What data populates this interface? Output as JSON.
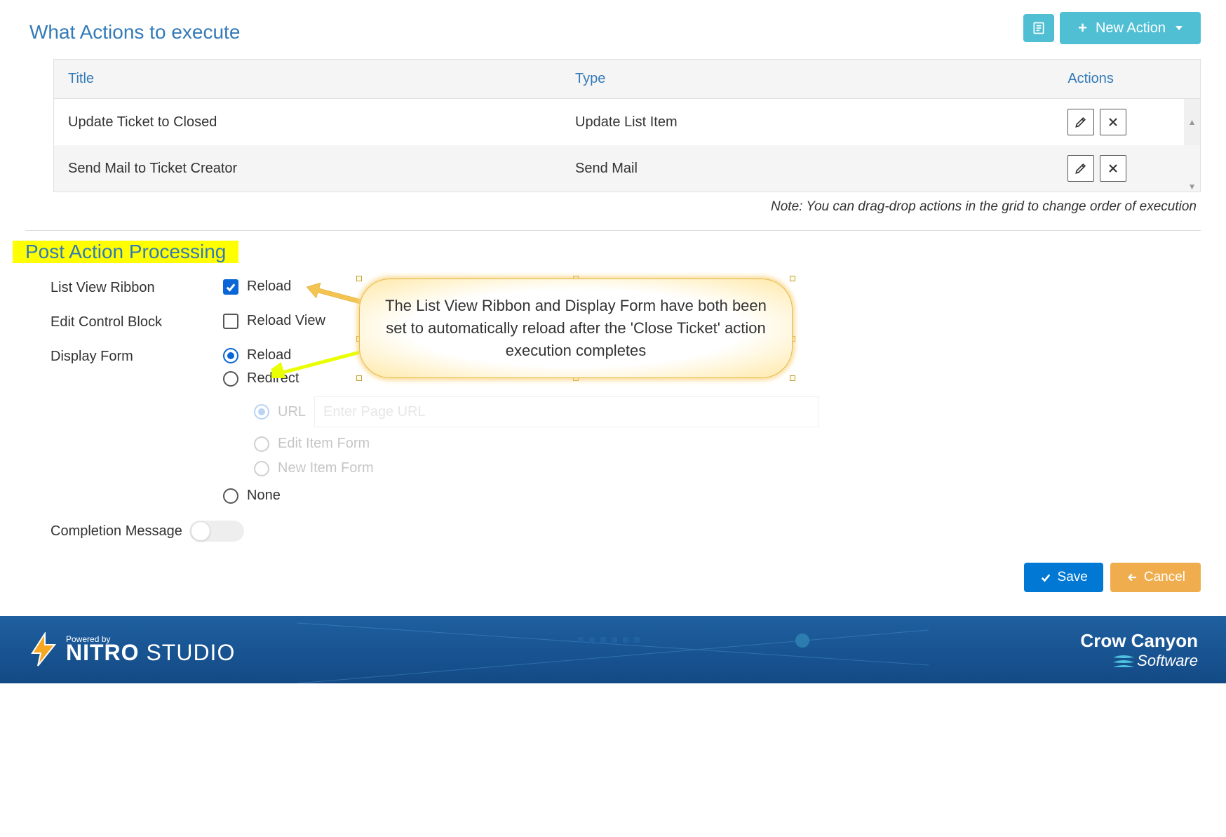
{
  "header": {
    "title": "What Actions to execute",
    "new_action_label": "New Action"
  },
  "grid": {
    "col_title": "Title",
    "col_type": "Type",
    "col_actions": "Actions",
    "rows": [
      {
        "title": "Update Ticket to Closed",
        "type": "Update List Item"
      },
      {
        "title": "Send Mail to Ticket Creator",
        "type": "Send Mail"
      }
    ],
    "note": "Note: You can drag-drop actions in the grid to change order of execution"
  },
  "post_action": {
    "section_title": "Post Action Processing",
    "list_view_ribbon_label": "List View Ribbon",
    "list_view_ribbon_opt": "Reload",
    "edit_control_block_label": "Edit Control Block",
    "edit_control_block_opt": "Reload View",
    "display_form_label": "Display Form",
    "display_form_reload": "Reload",
    "display_form_redirect": "Redirect",
    "redirect_url_label": "URL",
    "redirect_url_placeholder": "Enter Page URL",
    "redirect_edit_item": "Edit Item Form",
    "redirect_new_item": "New Item Form",
    "display_form_none": "None",
    "completion_msg_label": "Completion Message"
  },
  "callout": {
    "text": "The List View Ribbon and Display Form have both been set to automatically reload after the 'Close Ticket' action execution completes"
  },
  "buttons": {
    "save": "Save",
    "cancel": "Cancel"
  },
  "footer": {
    "powered_by": "Powered by",
    "nitro_bold": "NITRO",
    "nitro_light": " STUDIO",
    "cc_line1": "Crow Canyon",
    "cc_line2": "Software"
  }
}
